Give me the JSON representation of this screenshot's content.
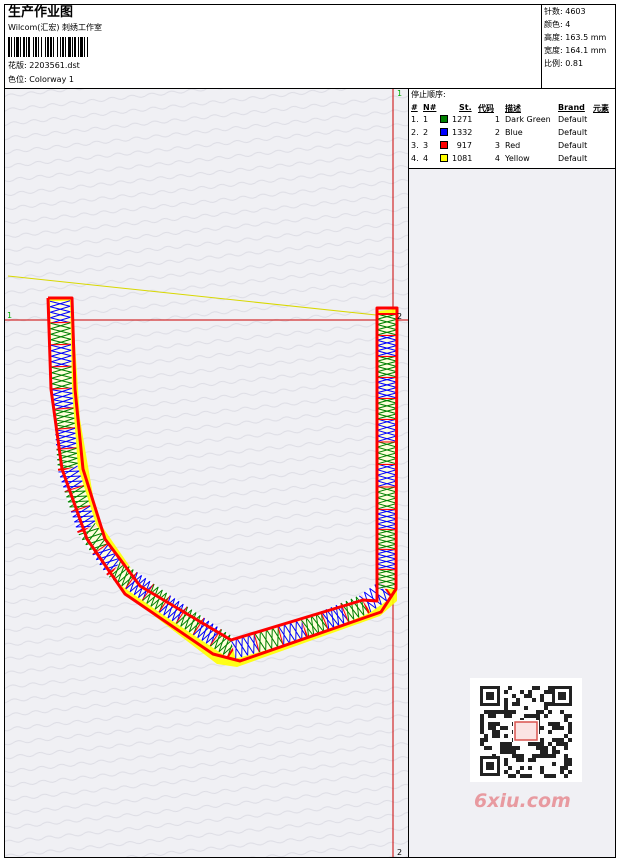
{
  "header": {
    "title": "生产作业图",
    "company": "Wilcom(汇宏) 刺绣工作室",
    "design_label": "花版:",
    "design_value": "2203561.dst",
    "colorway_label": "色位:",
    "colorway_value": "Colorway 1"
  },
  "stats": [
    {
      "label": "针数:",
      "value": "4603"
    },
    {
      "label": "颜色:",
      "value": "4"
    },
    {
      "label": "高度:",
      "value": "163.5 mm"
    },
    {
      "label": "宽度:",
      "value": "164.1 mm"
    },
    {
      "label": "比例:",
      "value": "0.81"
    }
  ],
  "stop_sequence": {
    "title": "停止顺序:",
    "headers": [
      "#",
      "N#",
      "St.",
      "代码",
      "描述",
      "Brand",
      "元素"
    ],
    "rows": [
      {
        "num": "1.",
        "n": "1",
        "color": "#008000",
        "stitches": "1271",
        "code": "1",
        "desc": "Dark Green",
        "brand": "Default"
      },
      {
        "num": "2.",
        "n": "2",
        "color": "#0000ff",
        "stitches": "1332",
        "code": "2",
        "desc": "Blue",
        "brand": "Default"
      },
      {
        "num": "3.",
        "n": "3",
        "color": "#ff0000",
        "stitches": "917",
        "code": "3",
        "desc": "Red",
        "brand": "Default"
      },
      {
        "num": "4.",
        "n": "4",
        "color": "#ffff00",
        "stitches": "1081",
        "code": "4",
        "desc": "Yellow",
        "brand": "Default"
      }
    ]
  },
  "markers": {
    "top_left": "1",
    "top_right": "1",
    "center_right": "2",
    "bottom_right": "2"
  },
  "thread_colors": {
    "green": "#008000",
    "blue": "#0000ff",
    "red": "#ff0000",
    "yellow": "#ffff00",
    "guide": "#cc0000"
  },
  "watermark": "6xiu.com"
}
